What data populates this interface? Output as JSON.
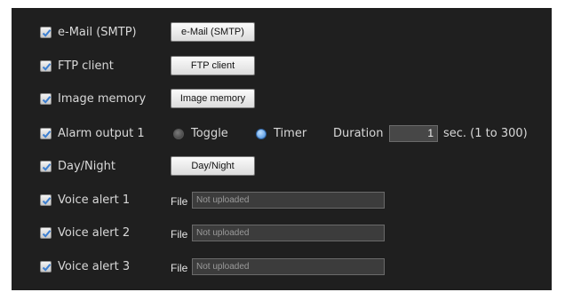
{
  "rows": [
    {
      "label": "e-Mail (SMTP)",
      "checked": true,
      "button": "e-Mail (SMTP)"
    },
    {
      "label": "FTP client",
      "checked": true,
      "button": "FTP client"
    },
    {
      "label": "Image memory",
      "checked": true,
      "button": "Image memory"
    },
    {
      "label": "Alarm output 1",
      "checked": true,
      "toggle_label": "Toggle",
      "timer_label": "Timer",
      "selected_mode": "Timer",
      "duration_label": "Duration",
      "duration_value": "1",
      "duration_unit": "sec. (1 to 300)"
    },
    {
      "label": "Day/Night",
      "checked": true,
      "button": "Day/Night"
    },
    {
      "label": "Voice alert 1",
      "checked": true,
      "file_label": "File",
      "file_value": "Not uploaded"
    },
    {
      "label": "Voice alert 2",
      "checked": true,
      "file_label": "File",
      "file_value": "Not uploaded"
    },
    {
      "label": "Voice alert 3",
      "checked": true,
      "file_label": "File",
      "file_value": "Not uploaded"
    }
  ],
  "colors": {
    "panel": "#1f1f1f",
    "radio_selected": "#3d86d8",
    "check": "#3d7fd0"
  }
}
